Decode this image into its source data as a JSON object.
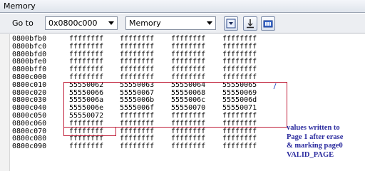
{
  "window": {
    "title": "Memory"
  },
  "toolbar": {
    "goto_label": "Go to",
    "address_value": "0x0800c000",
    "memory_type_value": "Memory"
  },
  "memory": {
    "rows": [
      {
        "addr": "0800bfb0",
        "words": [
          "ffffffff",
          "ffffffff",
          "ffffffff",
          "ffffffff"
        ]
      },
      {
        "addr": "0800bfc0",
        "words": [
          "ffffffff",
          "ffffffff",
          "ffffffff",
          "ffffffff"
        ]
      },
      {
        "addr": "0800bfd0",
        "words": [
          "ffffffff",
          "ffffffff",
          "ffffffff",
          "ffffffff"
        ]
      },
      {
        "addr": "0800bfe0",
        "words": [
          "ffffffff",
          "ffffffff",
          "ffffffff",
          "ffffffff"
        ]
      },
      {
        "addr": "0800bff0",
        "words": [
          "ffffffff",
          "ffffffff",
          "ffffffff",
          "ffffffff"
        ]
      },
      {
        "addr": "0800c000",
        "words": [
          "ffffffff",
          "ffffffff",
          "ffffffff",
          "ffffffff"
        ]
      },
      {
        "addr": "0800c010",
        "words": [
          "55550062",
          "55550063",
          "55550064",
          "55550065"
        ]
      },
      {
        "addr": "0800c020",
        "words": [
          "55550066",
          "55550067",
          "55550068",
          "55550069"
        ]
      },
      {
        "addr": "0800c030",
        "words": [
          "5555006a",
          "5555006b",
          "5555006c",
          "5555006d"
        ]
      },
      {
        "addr": "0800c040",
        "words": [
          "5555006e",
          "5555006f",
          "55550070",
          "55550071"
        ]
      },
      {
        "addr": "0800c050",
        "words": [
          "55550072",
          "ffffffff",
          "ffffffff",
          "ffffffff"
        ]
      },
      {
        "addr": "0800c060",
        "words": [
          "ffffffff",
          "ffffffff",
          "ffffffff",
          "ffffffff"
        ]
      },
      {
        "addr": "0800c070",
        "words": [
          "ffffffff",
          "ffffffff",
          "ffffffff",
          "ffffffff"
        ]
      },
      {
        "addr": "0800c080",
        "words": [
          "ffffffff",
          "ffffffff",
          "ffffffff",
          "ffffffff"
        ]
      },
      {
        "addr": "0800c090",
        "words": [
          "ffffffff",
          "ffffffff",
          "ffffffff",
          "ffffffff"
        ]
      }
    ]
  },
  "annotation": {
    "lines": [
      "values written to",
      "Page 1 after erase",
      "& marking page0",
      "VALID_PAGE"
    ],
    "color": "#2a2a9e",
    "box_color": "#c0203a"
  },
  "icons": [
    "dropdown-arrow-icon",
    "step-icon",
    "watch-icon"
  ]
}
